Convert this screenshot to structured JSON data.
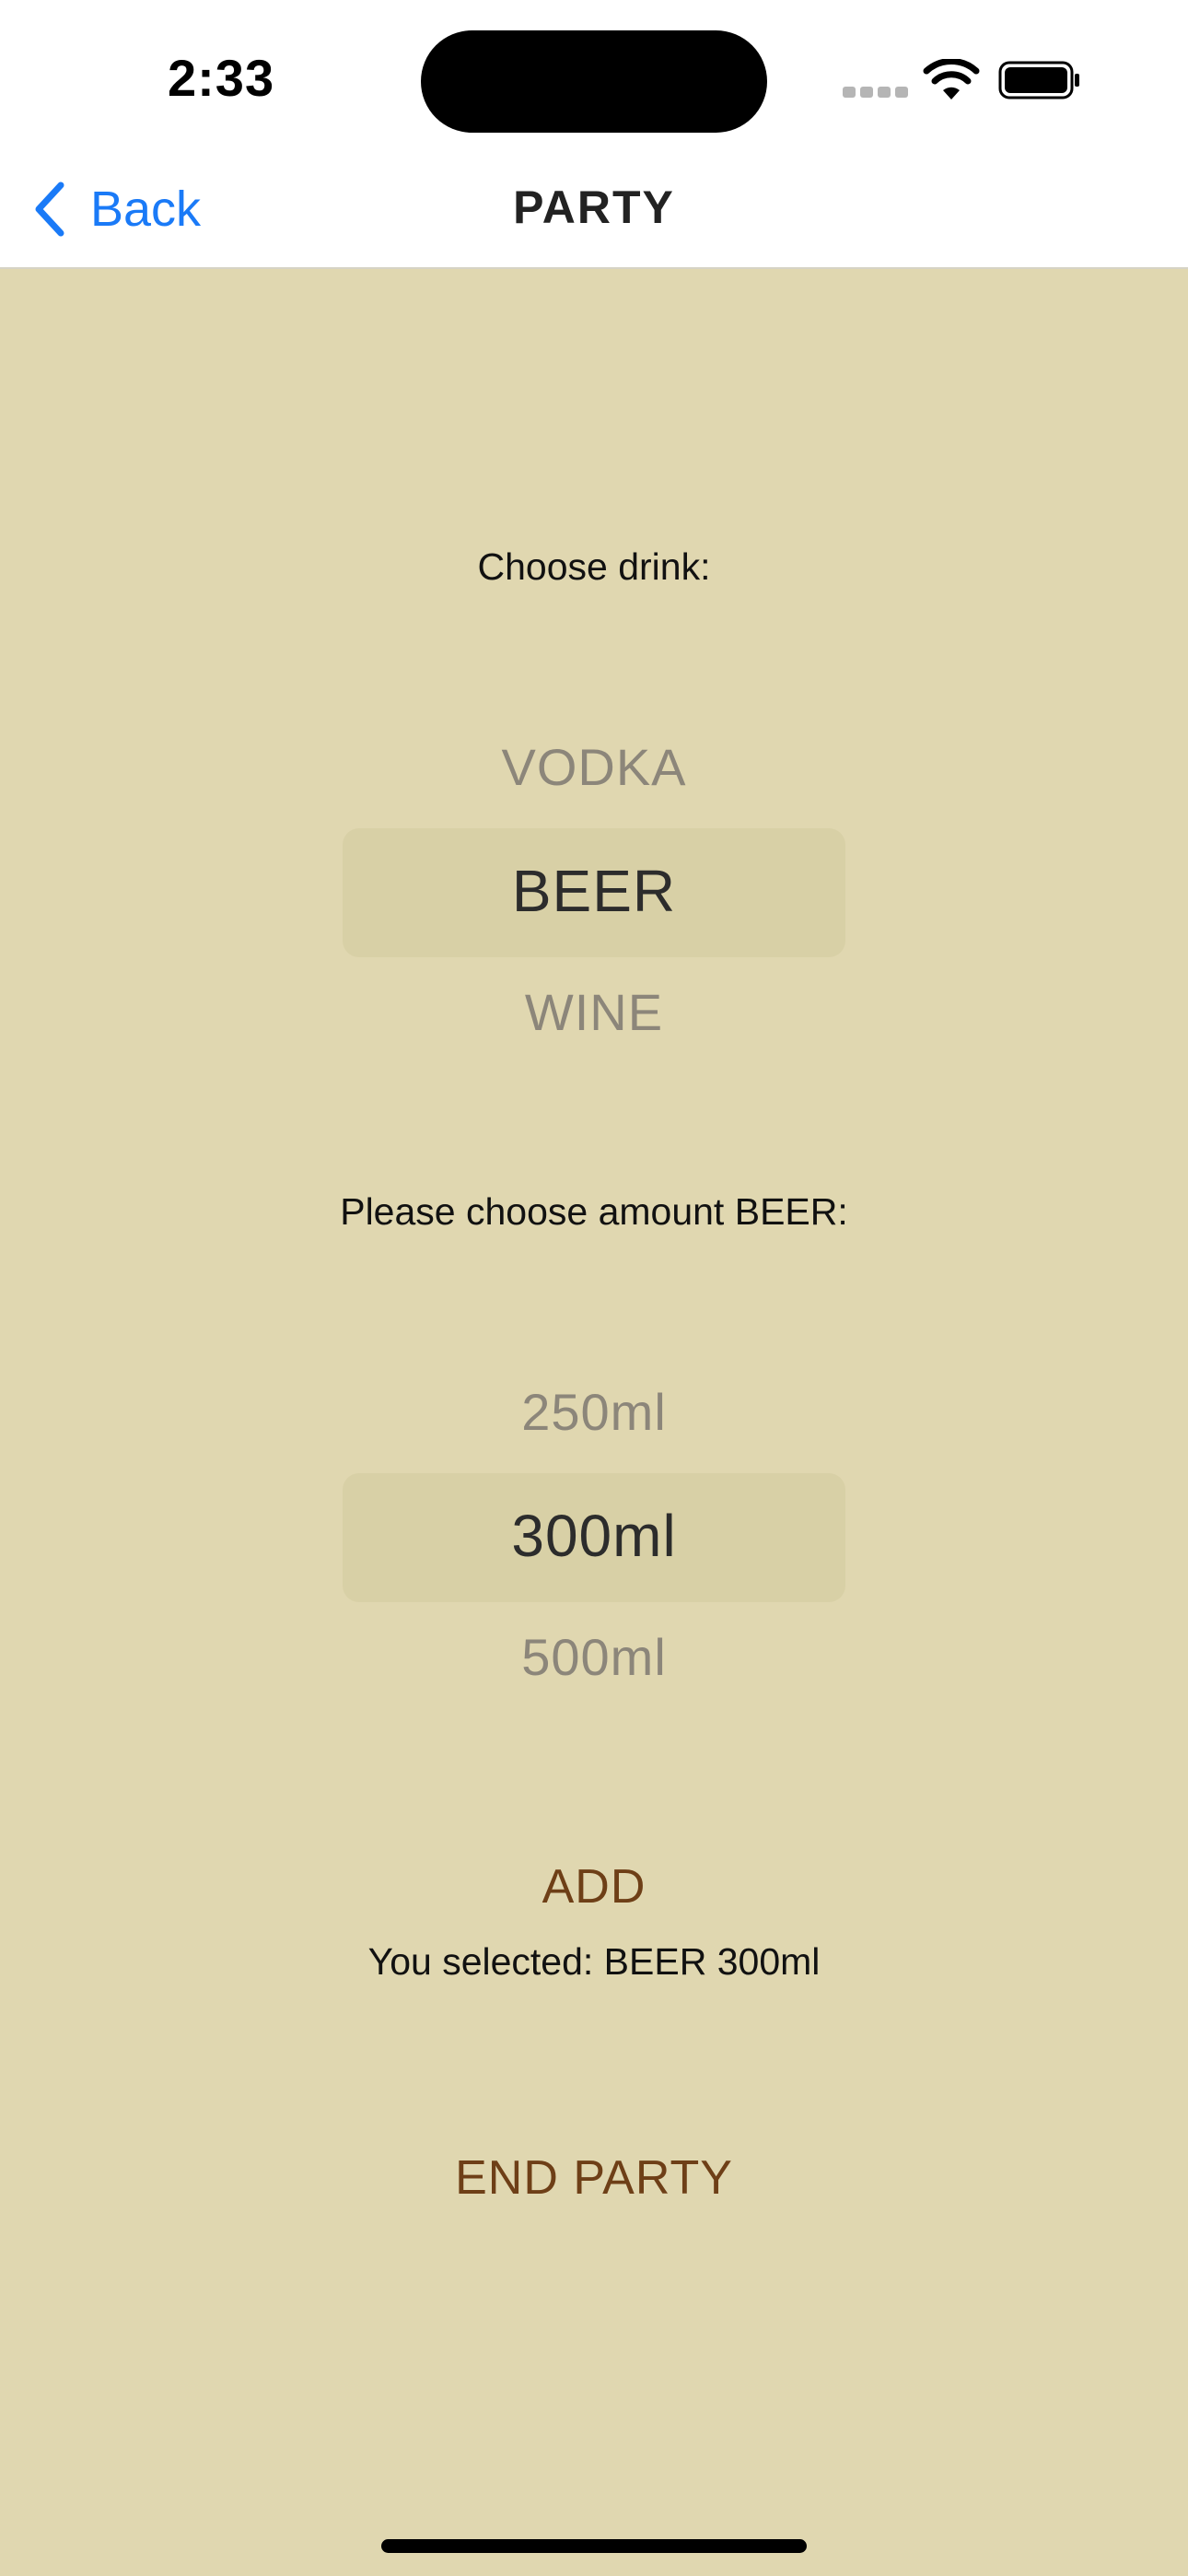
{
  "status_bar": {
    "time": "2:33"
  },
  "nav": {
    "back_label": "Back",
    "title": "PARTY"
  },
  "drink": {
    "prompt": "Choose drink:",
    "options": [
      "VODKA",
      "BEER",
      "WINE"
    ],
    "selected": "BEER"
  },
  "amount": {
    "prompt": "Please choose amount BEER:",
    "options": [
      "250ml",
      "300ml",
      "500ml"
    ],
    "selected": "300ml"
  },
  "add_label": "ADD",
  "selection_text": "You selected: BEER 300ml",
  "end_label": "END PARTY",
  "colors": {
    "background": "#e0d7b0",
    "accent_link": "#1a7af7",
    "action_text": "#6e3f17",
    "picker_highlight": "#d8d0a6"
  },
  "icons": [
    "back-chevron-icon",
    "cellular-signal-icon",
    "wifi-icon",
    "battery-icon"
  ]
}
